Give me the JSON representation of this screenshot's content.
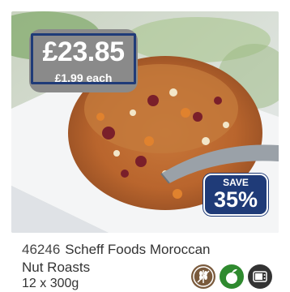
{
  "product": {
    "price": "£23.85",
    "unit_price": "£1.99 each",
    "save_label": "SAVE",
    "save_percent": "35%",
    "code": "46246",
    "name_line1": "Scheff Foods Moroccan",
    "name_line2": "Nut Roasts",
    "pack_size": "12 x 300g"
  },
  "icons": [
    "wheat-free-icon",
    "vegetarian-icon",
    "microwave-icon"
  ],
  "colors": {
    "badge_blue": "#1f3b78",
    "price_grey": "#8a8a8a",
    "grain_brown": "#7a5a3c",
    "veg_green": "#2f8a2f",
    "micro_dark": "#333333"
  }
}
